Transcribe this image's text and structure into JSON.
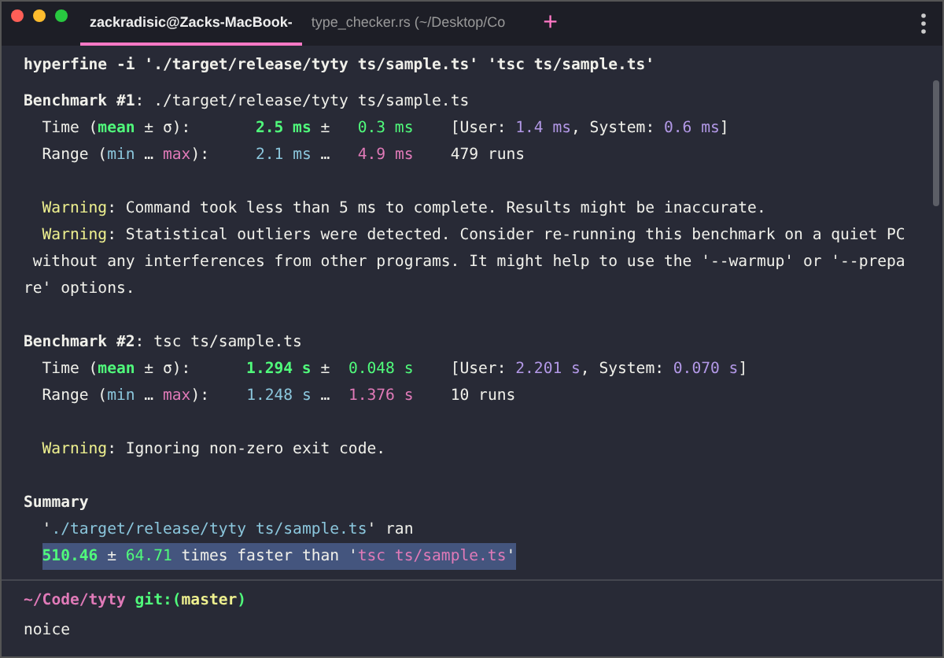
{
  "tabs": [
    {
      "label": "zackradisic@Zacks-MacBook-",
      "selected": true
    },
    {
      "label": "type_checker.rs (~/Desktop/Co",
      "selected": false
    }
  ],
  "new_tab": {
    "label": "+"
  },
  "command": {
    "text": "hyperfine -i './target/release/tyty ts/sample.ts' 'tsc ts/sample.ts'"
  },
  "output_blocks": [
    {
      "lines": [
        {
          "kind": "flush",
          "selected": false,
          "segments": [
            {
              "text": "Benchmark #1",
              "kind": "bold"
            },
            {
              "text": ": ./target/release/tyty ts/sample.ts",
              "kind": "plain"
            }
          ]
        },
        {
          "kind": "item",
          "selected": false,
          "segments": [
            {
              "text": "Time (",
              "kind": "plain"
            },
            {
              "text": "mean",
              "kind": "green_bold"
            },
            {
              "text": " ± σ):       ",
              "kind": "plain"
            },
            {
              "text": "2.5 ms",
              "kind": "green_bold"
            },
            {
              "text": " ±   ",
              "kind": "plain"
            },
            {
              "text": "0.3 ms",
              "kind": "green"
            },
            {
              "text": "    [User: ",
              "kind": "plain"
            },
            {
              "text": "1.4 ms",
              "kind": "purple"
            },
            {
              "text": ", System: ",
              "kind": "plain"
            },
            {
              "text": "0.6 ms",
              "kind": "purple"
            },
            {
              "text": "]",
              "kind": "plain"
            }
          ]
        },
        {
          "kind": "item",
          "selected": false,
          "segments": [
            {
              "text": "Range (",
              "kind": "plain"
            },
            {
              "text": "min",
              "kind": "cyan"
            },
            {
              "text": " … ",
              "kind": "plain"
            },
            {
              "text": "max",
              "kind": "pink"
            },
            {
              "text": "):     ",
              "kind": "plain"
            },
            {
              "text": "2.1 ms",
              "kind": "cyan"
            },
            {
              "text": " …   ",
              "kind": "plain"
            },
            {
              "text": "4.9 ms",
              "kind": "pink"
            },
            {
              "text": "    479 runs",
              "kind": "plain"
            }
          ]
        }
      ]
    },
    {
      "lines": [
        {
          "kind": "item",
          "selected": false,
          "segments": [
            {
              "text": "Warning",
              "kind": "yellow"
            },
            {
              "text": ": Command took less than 5 ms to complete. Results might be inaccurate.",
              "kind": "plain"
            }
          ]
        },
        {
          "kind": "item",
          "selected": false,
          "segments": [
            {
              "text": "Warning",
              "kind": "yellow"
            },
            {
              "text": ": Statistical outliers were detected. Consider re-running this benchmark on a quiet PC",
              "kind": "plain"
            }
          ]
        },
        {
          "kind": "hang",
          "selected": false,
          "segments": [
            {
              "text": "without any interferences from other programs. It might help to use the '--warmup' or '--prepa",
              "kind": "plain"
            }
          ]
        },
        {
          "kind": "flush",
          "selected": false,
          "segments": [
            {
              "text": "re' options.",
              "kind": "plain"
            }
          ]
        }
      ]
    },
    {
      "lines": [
        {
          "kind": "flush",
          "selected": false,
          "segments": [
            {
              "text": "Benchmark #2",
              "kind": "bold"
            },
            {
              "text": ": tsc ts/sample.ts",
              "kind": "plain"
            }
          ]
        },
        {
          "kind": "item",
          "selected": false,
          "segments": [
            {
              "text": "Time (",
              "kind": "plain"
            },
            {
              "text": "mean",
              "kind": "green_bold"
            },
            {
              "text": " ± σ):      ",
              "kind": "plain"
            },
            {
              "text": "1.294 s",
              "kind": "green_bold"
            },
            {
              "text": " ±  ",
              "kind": "plain"
            },
            {
              "text": "0.048 s",
              "kind": "green"
            },
            {
              "text": "    [User: ",
              "kind": "plain"
            },
            {
              "text": "2.201 s",
              "kind": "purple"
            },
            {
              "text": ", System: ",
              "kind": "plain"
            },
            {
              "text": "0.070 s",
              "kind": "purple"
            },
            {
              "text": "]",
              "kind": "plain"
            }
          ]
        },
        {
          "kind": "item",
          "selected": false,
          "segments": [
            {
              "text": "Range (",
              "kind": "plain"
            },
            {
              "text": "min",
              "kind": "cyan"
            },
            {
              "text": " … ",
              "kind": "plain"
            },
            {
              "text": "max",
              "kind": "pink"
            },
            {
              "text": "):    ",
              "kind": "plain"
            },
            {
              "text": "1.248 s",
              "kind": "cyan"
            },
            {
              "text": " …  ",
              "kind": "plain"
            },
            {
              "text": "1.376 s",
              "kind": "pink"
            },
            {
              "text": "    10 runs",
              "kind": "plain"
            }
          ]
        }
      ]
    },
    {
      "lines": [
        {
          "kind": "item",
          "selected": false,
          "segments": [
            {
              "text": "Warning",
              "kind": "yellow"
            },
            {
              "text": ": Ignoring non-zero exit code.",
              "kind": "plain"
            }
          ]
        }
      ]
    },
    {
      "lines": [
        {
          "kind": "flush",
          "selected": false,
          "segments": [
            {
              "text": "Summary",
              "kind": "bold"
            }
          ]
        },
        {
          "kind": "item",
          "selected": false,
          "segments": [
            {
              "text": "'",
              "kind": "plain"
            },
            {
              "text": "./target/release/tyty ts/sample.ts",
              "kind": "cyan"
            },
            {
              "text": "' ran",
              "kind": "plain"
            }
          ]
        },
        {
          "kind": "item",
          "selected": true,
          "segments": [
            {
              "text": "510.46",
              "kind": "green_bold"
            },
            {
              "text": " ± ",
              "kind": "plain"
            },
            {
              "text": "64.71",
              "kind": "green"
            },
            {
              "text": " times faster than '",
              "kind": "plain"
            },
            {
              "text": "tsc ts/sample.ts",
              "kind": "pink"
            },
            {
              "text": "'",
              "kind": "plain"
            }
          ]
        }
      ]
    }
  ],
  "prompt_lines": [
    {
      "selected": false,
      "segments": [
        {
          "text": "~/Code/tyty",
          "kind": "pink_bold"
        },
        {
          "text": " git:(",
          "kind": "green_bold"
        },
        {
          "text": "master",
          "kind": "yellow_bold"
        },
        {
          "text": ")",
          "kind": "green_bold"
        }
      ]
    },
    {
      "selected": false,
      "segments": [
        {
          "text": "noice",
          "kind": "plain"
        }
      ]
    }
  ]
}
